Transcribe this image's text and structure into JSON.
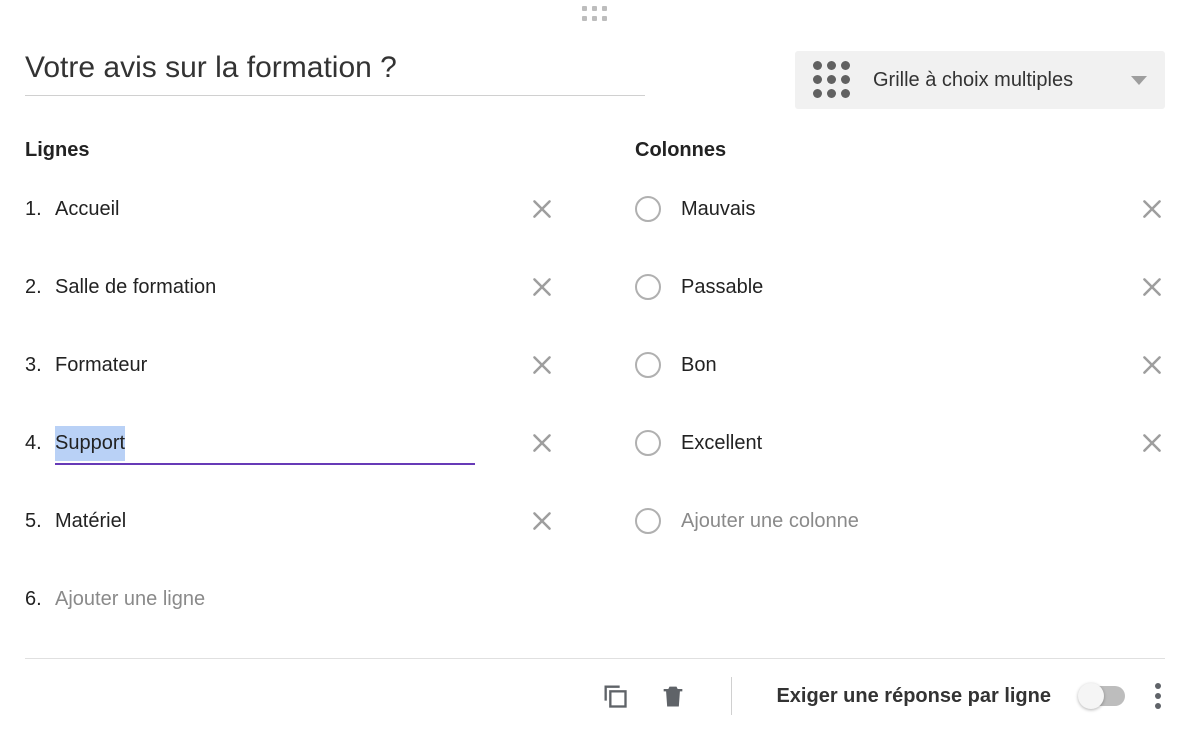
{
  "question_title": "Votre avis sur la formation ?",
  "type_selector": {
    "label": "Grille à choix multiples"
  },
  "rows": {
    "heading": "Lignes",
    "items": [
      {
        "index": "1.",
        "label": "Accueil",
        "removable": true,
        "active": false
      },
      {
        "index": "2.",
        "label": "Salle de formation",
        "removable": true,
        "active": false
      },
      {
        "index": "3.",
        "label": "Formateur",
        "removable": true,
        "active": false
      },
      {
        "index": "4.",
        "label": "Support",
        "removable": true,
        "active": true
      },
      {
        "index": "5.",
        "label": "Matériel",
        "removable": true,
        "active": false
      }
    ],
    "add_placeholder": {
      "index": "6.",
      "label": "Ajouter une ligne"
    }
  },
  "columns": {
    "heading": "Colonnes",
    "items": [
      {
        "label": "Mauvais",
        "removable": true
      },
      {
        "label": "Passable",
        "removable": true
      },
      {
        "label": "Bon",
        "removable": true
      },
      {
        "label": "Excellent",
        "removable": true
      }
    ],
    "add_placeholder": {
      "label": "Ajouter une colonne"
    }
  },
  "footer": {
    "required_label": "Exiger une réponse par ligne",
    "required_on": false
  }
}
